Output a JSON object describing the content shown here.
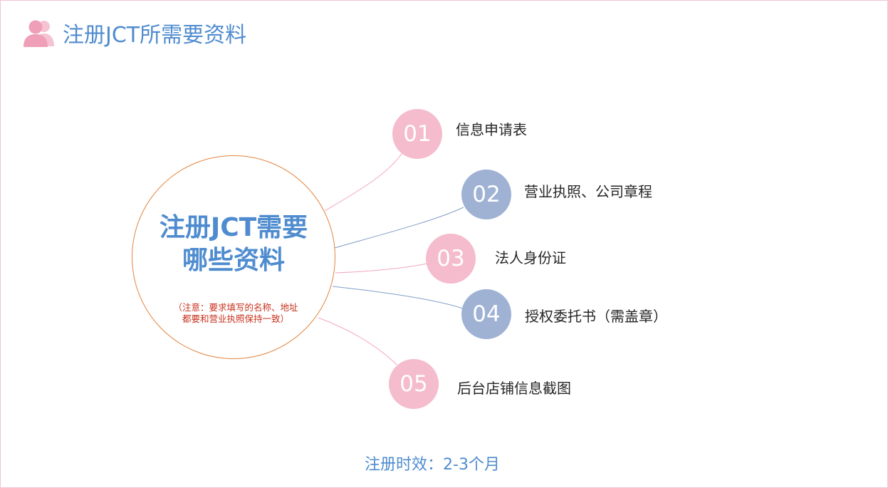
{
  "header": {
    "title": "注册JCT所需要资料",
    "icon": "users-icon",
    "accent_color": "#f0a3bb",
    "title_color": "#4f8ccf"
  },
  "center": {
    "title_line1": "注册JCT需要",
    "title_line2": "哪些资料",
    "note": "（注意：要求填写的名称、地址都要和营业执照保持一致）",
    "border_color": "#e2843e"
  },
  "items": [
    {
      "number": "01",
      "label": "信息申请表",
      "color": "#f4bccd"
    },
    {
      "number": "02",
      "label": "营业执照、公司章程",
      "color": "#9fb2d4"
    },
    {
      "number": "03",
      "label": "法人身份证",
      "color": "#f4bccd"
    },
    {
      "number": "04",
      "label": "授权委托书（需盖章）",
      "color": "#9fb2d4"
    },
    {
      "number": "05",
      "label": "后台店铺信息截图",
      "color": "#f4bccd"
    }
  ],
  "footer": {
    "text": "注册时效：2-3个月"
  }
}
